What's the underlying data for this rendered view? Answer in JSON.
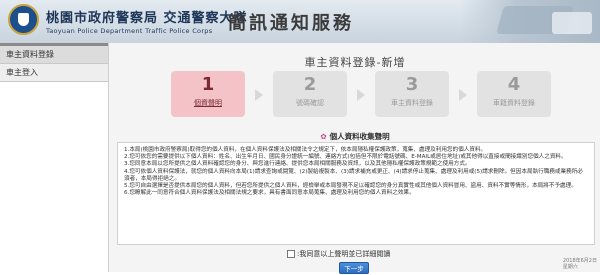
{
  "header": {
    "org_cn": "桃園市政府警察局 交通警察大隊",
    "org_en": "Taoyuan Police Department  Traffic Police Corps",
    "service_title": "簡訊通知服務"
  },
  "sidebar": {
    "items": [
      {
        "label": "車主資料登錄"
      },
      {
        "label": "車主登入"
      }
    ]
  },
  "main": {
    "page_title": "車主資料登錄-新增",
    "steps": [
      {
        "number": "1",
        "label": "個資聲明",
        "state": "active"
      },
      {
        "number": "2",
        "label": "號碼確認",
        "state": "inactive"
      },
      {
        "number": "3",
        "label": "車主資料登錄",
        "state": "inactive"
      },
      {
        "number": "4",
        "label": "車籍資料登錄",
        "state": "inactive"
      }
    ],
    "notice_title": "個人資料收集聲明",
    "notice_items": [
      "1.本局(桃園市政府警察局)取得您的個人資料，在個人資料保護法及相關法令之規定下，依本局隱私權保護政策，蒐集、處理及利用您的個人資料。",
      "2.您可依您的需要提供以下個人資料：姓名、出生年月日、國民身分證統一編號、連絡方式(包括但不限於電話號碼、E-MAIL或居住地址)或其他得以直接或間接識別您個人之資料。",
      "3.您同意本局以您所提供之個人資料確認您的身分、與您進行連絡、提供您本局相關服務及資訊，以及其他隱私權保護政策規範之使用方式。",
      "4.您可依個人資料保護法，就您的個人資料向本局(1)請求查詢或閱覽、(2)製給複製本、(3)請求補充或更正、(4)請求停止蒐集、處理及利用或(5)請求刪除。但因本局執行職務或業務所必須者，本局得拒絕之。",
      "5.您可自由選擇是否提供本局您的個人資料，但若您所提供之個人資料，經檢舉或本局發現不足以確認您的身分真實性或其他個人資料冒用、盜用、資料不實等情形，本局將不予處理。",
      "6.您瞭解此一同意符合個人資料保護法及相關法規之要求，具有書面同意本局蒐集、處理及利用您的個人資料之效果。"
    ],
    "agree_label": ":我同意以上聲明並已詳細閱讀",
    "next_label": "下一步"
  },
  "datetime": {
    "date": "2018年6月2日",
    "weekday": "星期六"
  },
  "colors": {
    "active_step": "#f4c3c8",
    "inactive_step": "#e2e2e2",
    "button": "#2d6cc0"
  }
}
